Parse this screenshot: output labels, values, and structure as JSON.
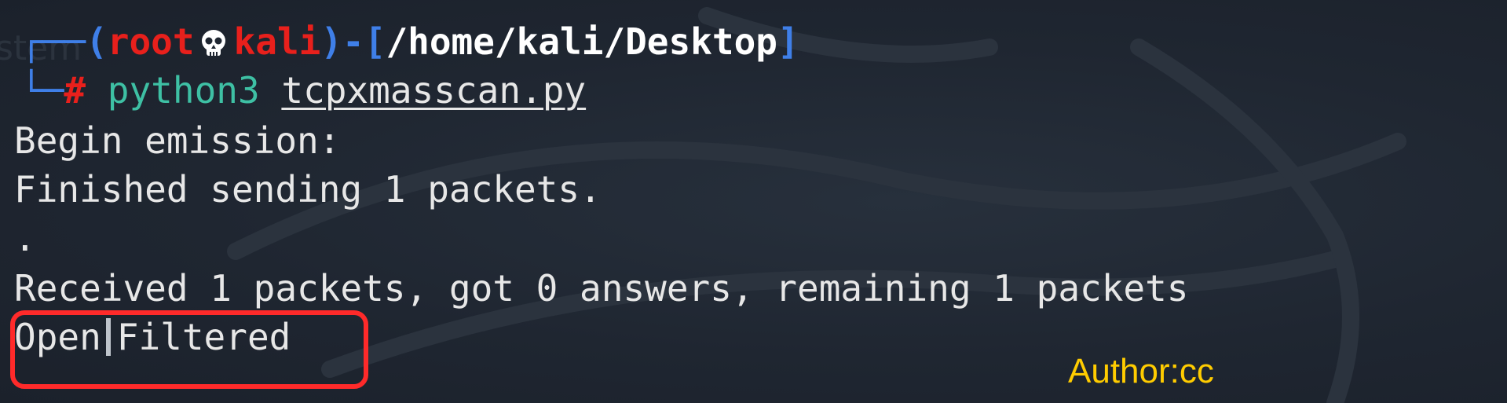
{
  "prompt": {
    "open_paren": "(",
    "user": "root",
    "host": "kali",
    "close_paren_dash": ")-[",
    "path": "/home/kali/Desktop",
    "close_bracket": "]",
    "symbol": "#",
    "command": "python3",
    "argument": "tcpxmasscan.py"
  },
  "output": {
    "line1": "Begin emission:",
    "line2": "Finished sending 1 packets.",
    "line3": ".",
    "line4": "Received 1 packets, got 0 answers, remaining 1 packets",
    "result_left": "Open",
    "result_right": "Filtered"
  },
  "ghost_text": "stem",
  "author_label": "Author:cc",
  "colors": {
    "background": "#1f2631",
    "prompt_frame": "#3f7fe8",
    "prompt_user": "#e8201c",
    "command": "#3ec0a4",
    "highlight_box": "#ff2a2a",
    "author": "#ffcc00"
  },
  "icons": {
    "prompt_separator": "skull-icon"
  }
}
